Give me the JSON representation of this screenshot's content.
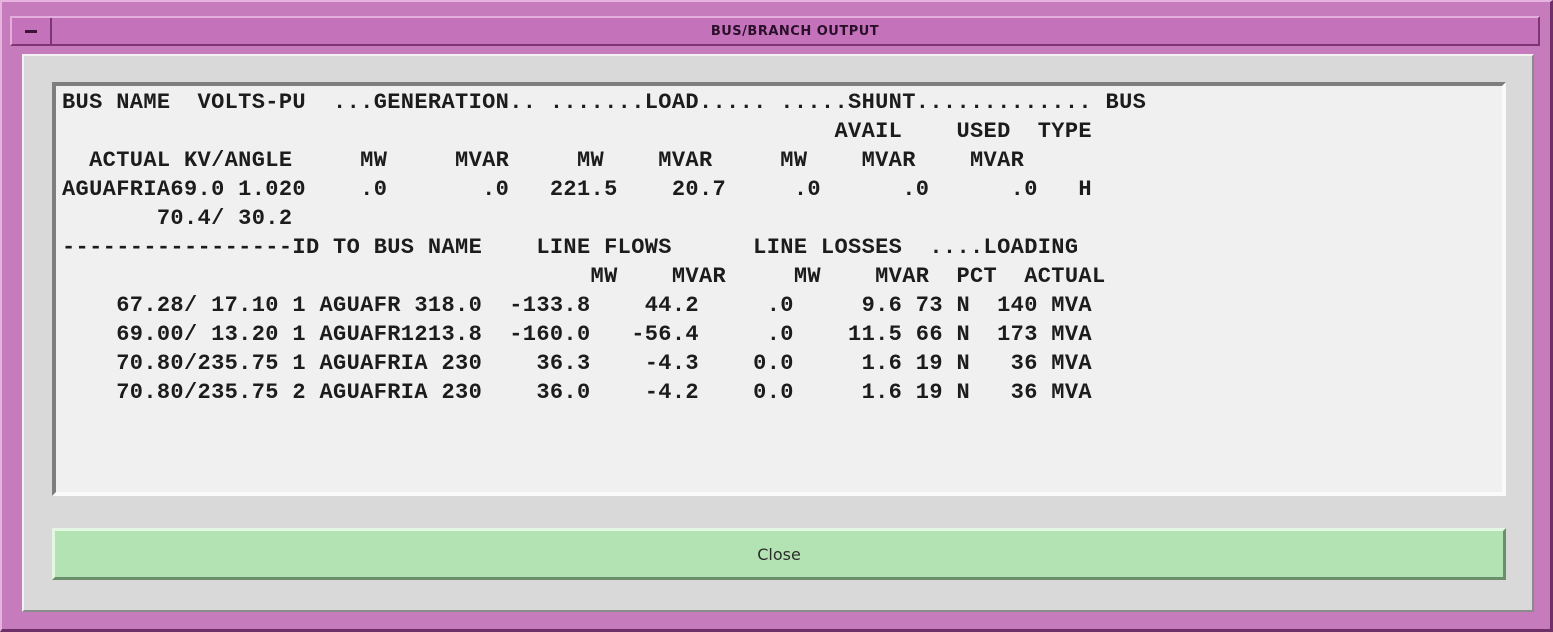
{
  "window": {
    "title": "BUS/BRANCH OUTPUT",
    "menu_icon": "window-menu-icon"
  },
  "report": {
    "lines": [
      "BUS NAME  VOLTS-PU  ...GENERATION.. .......LOAD..... .....SHUNT............. BUS",
      "                                                         AVAIL    USED  TYPE",
      "  ACTUAL KV/ANGLE     MW     MVAR     MW    MVAR     MW    MVAR    MVAR",
      "AGUAFRIA69.0 1.020    .0       .0   221.5    20.7     .0      .0      .0   H",
      "       70.4/ 30.2",
      "-----------------ID TO BUS NAME    LINE FLOWS      LINE LOSSES  ....LOADING",
      "                                       MW    MVAR     MW    MVAR  PCT  ACTUAL",
      "    67.28/ 17.10 1 AGUAFR 318.0  -133.8    44.2     .0     9.6 73 N  140 MVA",
      "    69.00/ 13.20 1 AGUAFR1213.8  -160.0   -56.4     .0    11.5 66 N  173 MVA",
      "    70.80/235.75 1 AGUAFRIA 230    36.3    -4.3    0.0     1.6 19 N   36 MVA",
      "    70.80/235.75 2 AGUAFRIA 230    36.0    -4.2    0.0     1.6 19 N   36 MVA"
    ]
  },
  "buttons": {
    "close_label": "Close"
  },
  "colors": {
    "frame": "#c67bbd",
    "client": "#d9d9d9",
    "output_bg": "#f0f0f0",
    "close_button": "#b3e3b3"
  }
}
